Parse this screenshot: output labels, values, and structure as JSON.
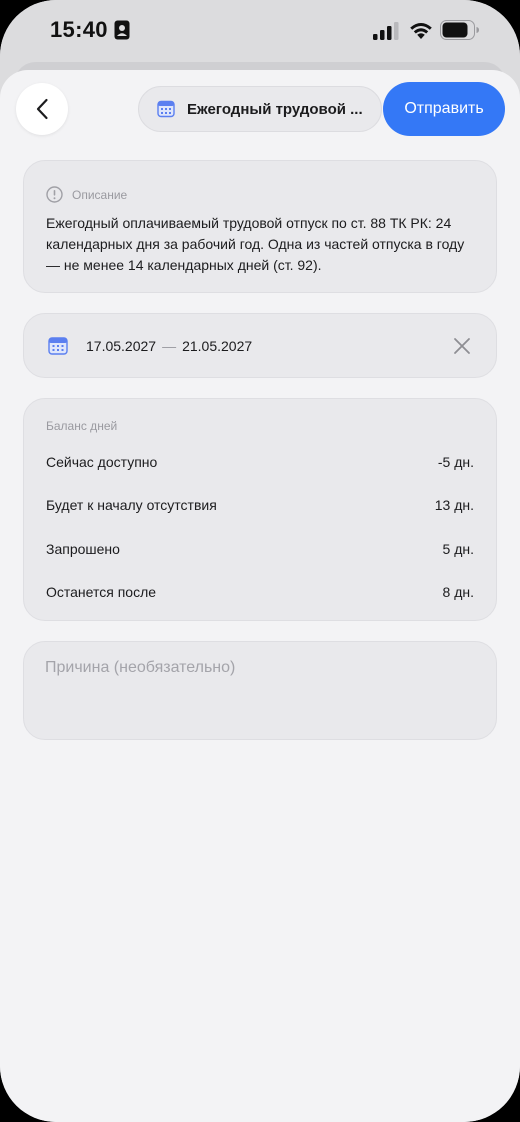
{
  "status_bar": {
    "time": "15:40"
  },
  "header": {
    "leave_type_label": "Ежегодный трудовой ...",
    "send_label": "Отправить"
  },
  "description": {
    "title": "Описание",
    "text": "Ежегодный оплачиваемый трудовой отпуск по ст. 88 ТК РК: 24 календарных дня за рабочий год. Одна из частей отпуска в году — не менее 14 календарных дней (ст. 92)."
  },
  "dates": {
    "start": "17.05.2027",
    "separator": "—",
    "end": "21.05.2027"
  },
  "balance": {
    "title": "Баланс дней",
    "rows": [
      {
        "label": "Сейчас доступно",
        "value": "-5 дн."
      },
      {
        "label": "Будет к началу отсутствия",
        "value": "13 дн."
      },
      {
        "label": "Запрошено",
        "value": "5 дн."
      },
      {
        "label": "Останется после",
        "value": "8 дн."
      }
    ]
  },
  "reason": {
    "placeholder": "Причина (необязательно)",
    "value": ""
  },
  "colors": {
    "accent": "#3478f6",
    "calendar_icon": "#5b7ff0"
  },
  "icons": {
    "back": "chevron-left-icon",
    "calendar": "calendar-icon",
    "info": "info-icon",
    "clear": "close-icon"
  }
}
